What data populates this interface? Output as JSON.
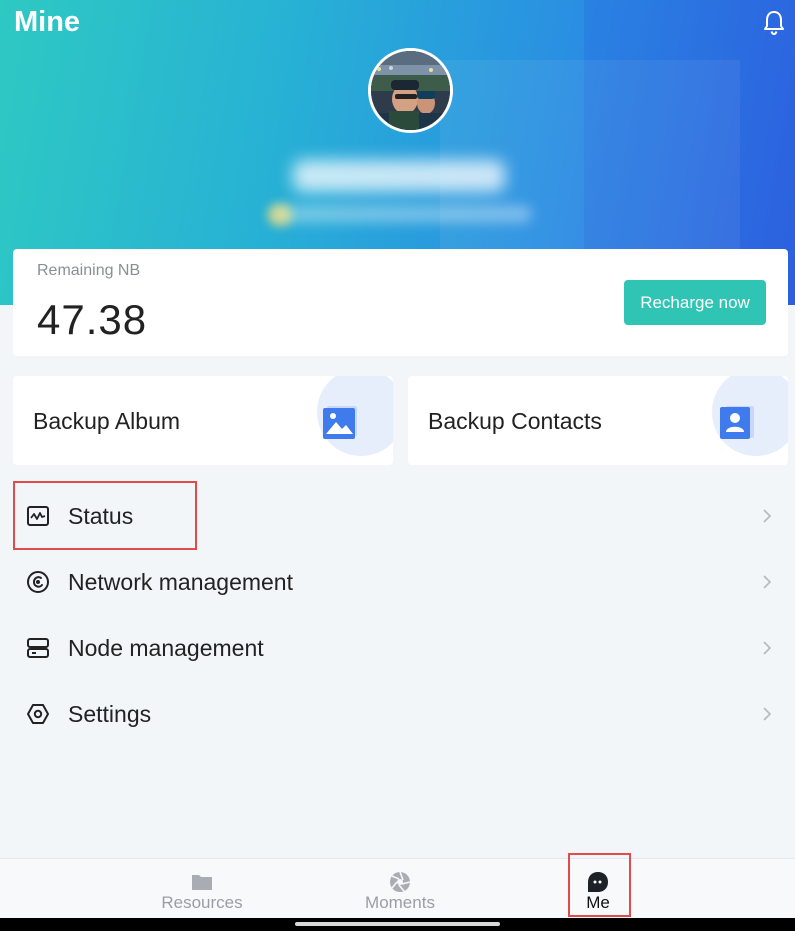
{
  "header": {
    "title": "Mine",
    "accent_from": "#2ec9c3",
    "accent_to": "#2f64e0"
  },
  "balance": {
    "label": "Remaining NB",
    "value": "47.38",
    "recharge_label": "Recharge now",
    "button_color": "#2fc4b4"
  },
  "tiles": [
    {
      "label": "Backup Album",
      "icon": "image-icon"
    },
    {
      "label": "Backup Contacts",
      "icon": "contact-icon"
    }
  ],
  "menu": [
    {
      "label": "Status",
      "icon": "activity-icon"
    },
    {
      "label": "Network management",
      "icon": "network-icon"
    },
    {
      "label": "Node management",
      "icon": "server-icon"
    },
    {
      "label": "Settings",
      "icon": "settings-icon"
    }
  ],
  "tabbar": [
    {
      "label": "Resources",
      "icon": "folder-icon",
      "active": false
    },
    {
      "label": "Moments",
      "icon": "aperture-icon",
      "active": false
    },
    {
      "label": "Me",
      "icon": "me-icon",
      "active": true
    }
  ],
  "highlight_color": "#e04b4b"
}
